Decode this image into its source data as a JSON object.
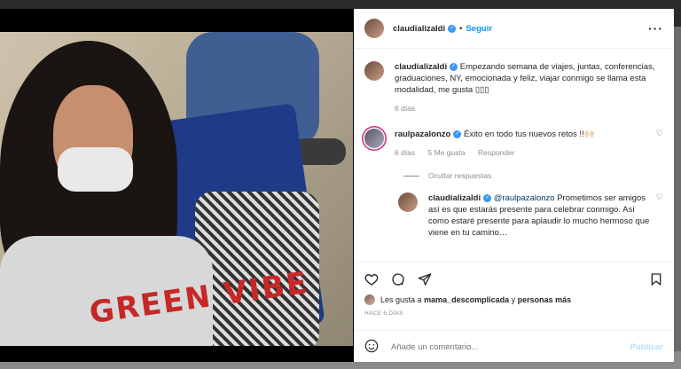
{
  "post": {
    "username": "claudializaldi",
    "follow_label": "Seguir",
    "caption": "Empezando semana de viajes, juntas, conferencias, graduaciones, NY, emocionada y feliz, viajar conmigo se llama esta modalidad, me gusta ▯▯▯",
    "caption_time": "6 días",
    "shirt_text": "GREEN VIBE"
  },
  "comments": [
    {
      "username": "raulpazalonzo",
      "text": "Éxito en todo tus nuevos retos !!🙌🏻",
      "time": "6 días",
      "likes": "5 Me gusta",
      "reply_label": "Responder",
      "hide_replies_label": "Ocultar respuestas",
      "replies": [
        {
          "username": "claudializaldi",
          "mention": "@raulpazalonzo",
          "text": "Prometimos ser amigos así es que estarás presente para celebrar conmigo. Así como estaré presente para aplaudir lo mucho hermoso que viene en tu camino…"
        }
      ]
    }
  ],
  "likes": {
    "prefix": "Les gusta a",
    "user": "mama_descomplicada",
    "connector": "y",
    "others": "personas más"
  },
  "time_ago": "HACE 6 DÍAS",
  "add_comment": {
    "placeholder": "Añade un comentario...",
    "publish_label": "Publicar"
  }
}
